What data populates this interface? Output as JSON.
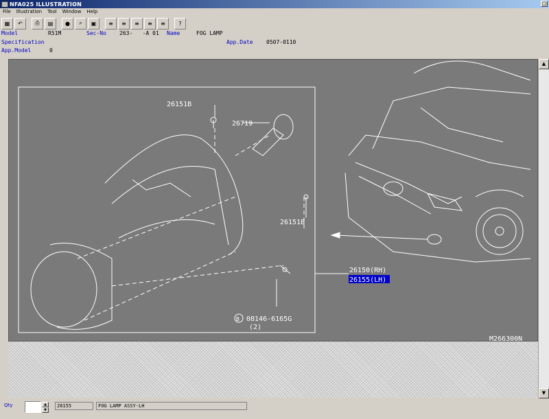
{
  "window": {
    "title": "NFA025 ILLUSTRATION"
  },
  "menu": {
    "items": [
      "File",
      "Illustration",
      "Tool",
      "Window",
      "Help"
    ]
  },
  "toolbar": {
    "buttons": [
      {
        "icon": "grid-icon",
        "glyph": "▦"
      },
      {
        "icon": "undo-icon",
        "glyph": "↶"
      },
      {
        "icon": "print-icon",
        "glyph": "⎙"
      },
      {
        "icon": "book-icon",
        "glyph": "▤"
      },
      {
        "icon": "circle-icon",
        "glyph": "●"
      },
      {
        "icon": "zoom-icon",
        "glyph": "⌕"
      },
      {
        "icon": "page-icon",
        "glyph": "▣"
      },
      {
        "icon": "list1-icon",
        "glyph": "≡"
      },
      {
        "icon": "list2-icon",
        "glyph": "≡"
      },
      {
        "icon": "list3-icon",
        "glyph": "≡"
      },
      {
        "icon": "list4-icon",
        "glyph": "≡"
      },
      {
        "icon": "list5-icon",
        "glyph": "≡"
      },
      {
        "icon": "help-icon",
        "glyph": "?"
      }
    ]
  },
  "info": {
    "model_label": "Model",
    "model_value": "R51M",
    "secno_label": "Sec-No",
    "secno_value": "263-   -A 01",
    "name_label": "Name",
    "name_value": "FOG LAMP",
    "spec_label": "Specification",
    "appdate_label": "App.Date",
    "appdate_value": "0507-0110",
    "appmodel_label": "App.Model",
    "appmodel_value": "0"
  },
  "drawing": {
    "callouts": [
      "26151B",
      "26719",
      "26151B",
      "26150(RH)",
      "26155(LH)",
      "B",
      "08146-6165G",
      "(2)"
    ],
    "figure_code": "M266300N",
    "highlight_color": "#0000c8"
  },
  "status": {
    "qty_label": "Qty",
    "qty_value": "",
    "part_number": "26155",
    "part_name": "FOG LAMP ASSY-LH"
  },
  "colors": {
    "panel_bg": "#7a7a7a",
    "line": "#ffffff",
    "label_blue": "#0000c0"
  }
}
